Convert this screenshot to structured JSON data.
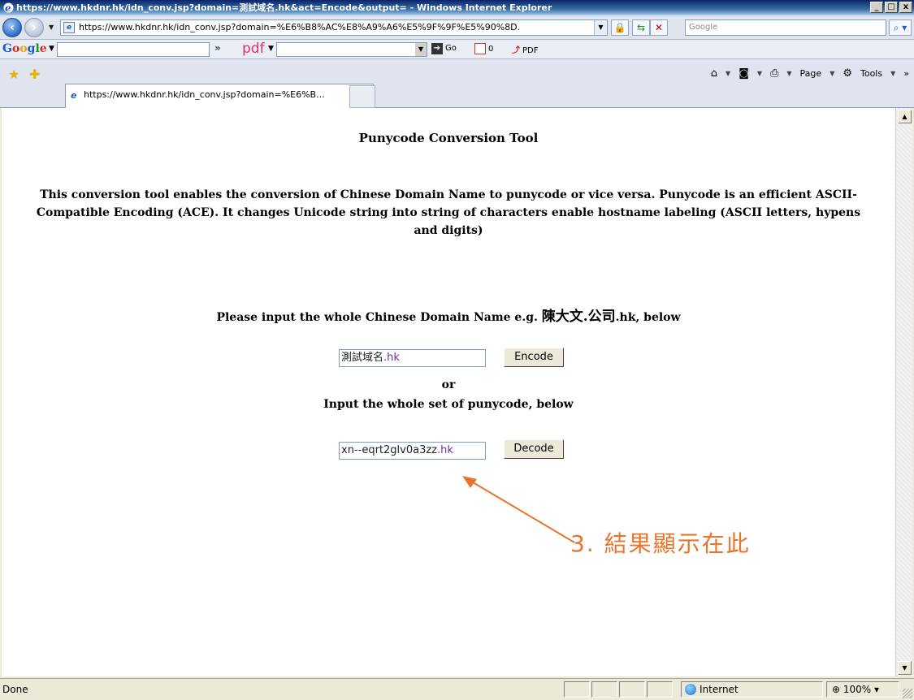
{
  "window": {
    "title": "https://www.hkdnr.hk/idn_conv.jsp?domain=測試域名.hk&act=Encode&output= - Windows Internet Explorer",
    "minimize": "_",
    "maximize": "□",
    "close": "x"
  },
  "address_bar": {
    "url": "https://www.hkdnr.hk/idn_conv.jsp?domain=%E6%B8%AC%E8%A9%A6%E5%9F%9F%E5%90%8D.",
    "search_placeholder": "Google"
  },
  "google_toolbar": {
    "logo": [
      "G",
      "o",
      "o",
      "g",
      "l",
      "e"
    ],
    "more": "»",
    "pdf_brand": "pdf",
    "go_label": "Go",
    "count_label": "0",
    "pdf_label": "PDF"
  },
  "tabs": [
    {
      "label": "https://www.hkdnr.hk/idn_conv.jsp?domain=%E6%B..."
    }
  ],
  "command_bar": {
    "page_label": "Page",
    "tools_label": "Tools",
    "more": "»"
  },
  "page": {
    "title": "Punycode Conversion Tool",
    "description": "This conversion tool enables the conversion of Chinese Domain Name to punycode or vice versa. Punycode is an efficient ASCII-Compatible Encoding (ACE). It changes Unicode string into string of characters enable hostname labeling (ASCII letters, hypens and digits)",
    "prompt_prefix": "Please input the whole Chinese Domain Name e.g. ",
    "prompt_example": "陳大文.公司",
    "prompt_suffix": ".hk, below",
    "encode_value_zh": "測試域名",
    "encode_value_ascii": ".hk",
    "encode_button": "Encode",
    "or_label": "or",
    "prompt2": "Input the whole set of punycode, below",
    "decode_value_main": "xn--eqrt2glv0a3zz",
    "decode_value_ascii": ".hk",
    "decode_button": "Decode",
    "annotation": "3. 結果顯示在此"
  },
  "status_bar": {
    "text": "Done",
    "zone": "Internet",
    "zoom": "100%"
  },
  "colors": {
    "annotation": "#e8742c",
    "title_bar": "#0a246a"
  }
}
